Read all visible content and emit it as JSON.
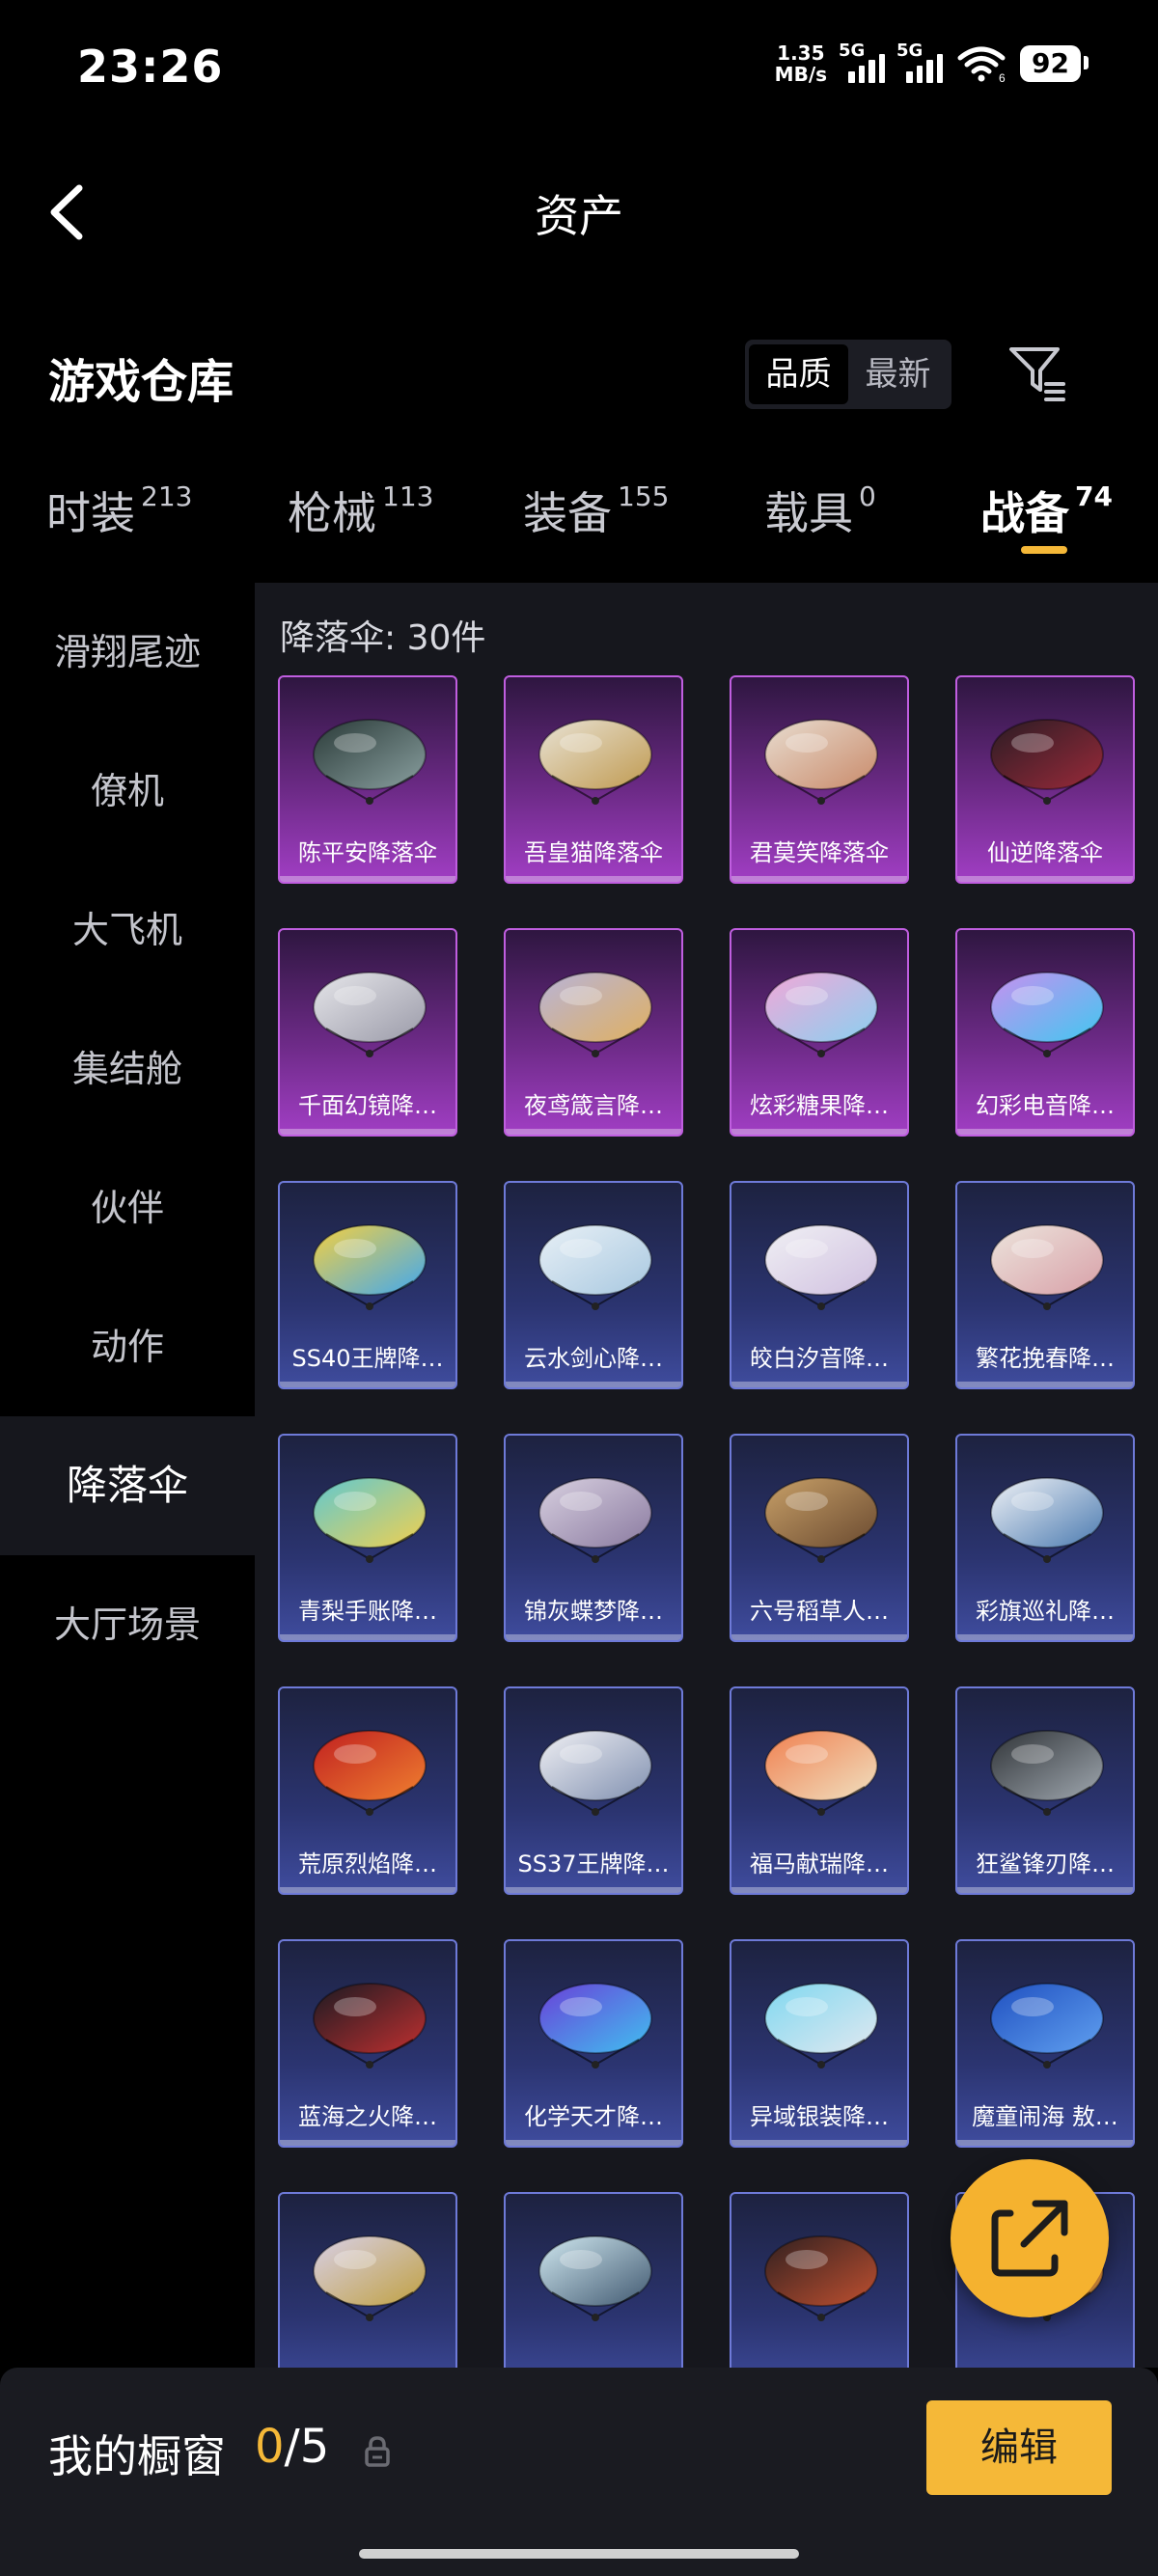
{
  "status_bar": {
    "time": "23:26",
    "speed_value": "1.35",
    "speed_unit": "MB/s",
    "sig1_label": "5G",
    "sig2_label": "5G",
    "wifi_badge": "6",
    "battery": "92"
  },
  "header": {
    "title": "资产"
  },
  "section": {
    "title": "游戏仓库",
    "sort_options": [
      "品质",
      "最新"
    ],
    "sort_active": "品质"
  },
  "category_tabs": [
    {
      "name": "时装",
      "count": "213"
    },
    {
      "name": "枪械",
      "count": "113"
    },
    {
      "name": "装备",
      "count": "155"
    },
    {
      "name": "载具",
      "count": "0"
    },
    {
      "name": "战备",
      "count": "74",
      "active": true
    }
  ],
  "sidebar": [
    {
      "label": "滑翔尾迹"
    },
    {
      "label": "僚机"
    },
    {
      "label": "大飞机"
    },
    {
      "label": "集结舱"
    },
    {
      "label": "伙伴"
    },
    {
      "label": "动作"
    },
    {
      "label": "降落伞",
      "active": true
    },
    {
      "label": "大厅场景"
    }
  ],
  "content": {
    "count_label": "降落伞: 30件"
  },
  "items": [
    {
      "name": "陈平安降落伞",
      "rarity": "purple",
      "colors": [
        "#2a3a38",
        "#8aa0a0"
      ]
    },
    {
      "name": "吾皇猫降落伞",
      "rarity": "purple",
      "colors": [
        "#e8e2d4",
        "#c09a50"
      ]
    },
    {
      "name": "君莫笑降落伞",
      "rarity": "purple",
      "colors": [
        "#e8ddd0",
        "#c98a6a"
      ]
    },
    {
      "name": "仙逆降落伞",
      "rarity": "purple",
      "colors": [
        "#2a1c24",
        "#9a2a3a"
      ]
    },
    {
      "name": "千面幻镜降…",
      "rarity": "purple",
      "colors": [
        "#e6e6ea",
        "#9a9aa8"
      ]
    },
    {
      "name": "夜鸢箴言降…",
      "rarity": "purple",
      "colors": [
        "#b8b4d8",
        "#e0b060"
      ]
    },
    {
      "name": "炫彩糖果降…",
      "rarity": "purple",
      "colors": [
        "#f2a8d8",
        "#8ad0f0"
      ]
    },
    {
      "name": "幻彩电音降…",
      "rarity": "purple",
      "colors": [
        "#c890f0",
        "#40c8f0"
      ]
    },
    {
      "name": "SS40王牌降…",
      "rarity": "blue",
      "colors": [
        "#f5d040",
        "#40a8f0"
      ]
    },
    {
      "name": "云水剑心降…",
      "rarity": "blue",
      "colors": [
        "#e8f0f6",
        "#a8c8e0"
      ]
    },
    {
      "name": "皎白汐音降…",
      "rarity": "blue",
      "colors": [
        "#f0f0f4",
        "#d0c0e0"
      ]
    },
    {
      "name": "繁花挽春降…",
      "rarity": "blue",
      "colors": [
        "#ece4dc",
        "#d8a0a8"
      ]
    },
    {
      "name": "青梨手账降…",
      "rarity": "blue",
      "colors": [
        "#60c8d0",
        "#f0d050"
      ]
    },
    {
      "name": "锦灰蝶梦降…",
      "rarity": "blue",
      "colors": [
        "#d8d0e0",
        "#8a7aa0"
      ]
    },
    {
      "name": "六号稻草人…",
      "rarity": "blue",
      "colors": [
        "#c8a068",
        "#6a4a30"
      ]
    },
    {
      "name": "彩旗巡礼降…",
      "rarity": "blue",
      "colors": [
        "#f0f2f6",
        "#4a7ab0"
      ]
    },
    {
      "name": "荒原烈焰降…",
      "rarity": "blue",
      "colors": [
        "#c02020",
        "#f08030"
      ]
    },
    {
      "name": "SS37王牌降…",
      "rarity": "blue",
      "colors": [
        "#f0f0f4",
        "#8090b0"
      ]
    },
    {
      "name": "福马献瑞降…",
      "rarity": "blue",
      "colors": [
        "#f08050",
        "#f0e0c0"
      ]
    },
    {
      "name": "狂鲨锋刃降…",
      "rarity": "blue",
      "colors": [
        "#303438",
        "#a0a8b0"
      ]
    },
    {
      "name": "蓝海之火降…",
      "rarity": "blue",
      "colors": [
        "#1a1a22",
        "#c03030"
      ]
    },
    {
      "name": "化学天才降…",
      "rarity": "blue",
      "colors": [
        "#6a40d8",
        "#40c0f0"
      ]
    },
    {
      "name": "异域银装降…",
      "rarity": "blue",
      "colors": [
        "#80d8f0",
        "#e0e8f0"
      ]
    },
    {
      "name": "魔童闹海 敖…",
      "rarity": "blue",
      "colors": [
        "#2050c0",
        "#60a0f0"
      ]
    },
    {
      "name": "",
      "rarity": "blue",
      "colors": [
        "#d8d0e8",
        "#c0a040"
      ]
    },
    {
      "name": "",
      "rarity": "blue",
      "colors": [
        "#d0e8f0",
        "#405870"
      ]
    },
    {
      "name": "",
      "rarity": "blue",
      "colors": [
        "#302020",
        "#c05030"
      ]
    },
    {
      "name": "",
      "rarity": "blue",
      "colors": [
        "#e04040",
        "#f0b040"
      ]
    }
  ],
  "bottom_bar": {
    "window_label": "我的橱窗",
    "window_current": "0",
    "window_total": "/5",
    "edit_label": "编辑"
  },
  "colors": {
    "accent": "#f5b838",
    "panel": "#16171d",
    "purple_rarity": "#c05ee0",
    "blue_rarity": "#6e7ad8"
  },
  "icons": {
    "back": "chevron-left-icon",
    "filter": "filter-icon",
    "lock": "lock-icon",
    "share": "external-link-icon"
  }
}
